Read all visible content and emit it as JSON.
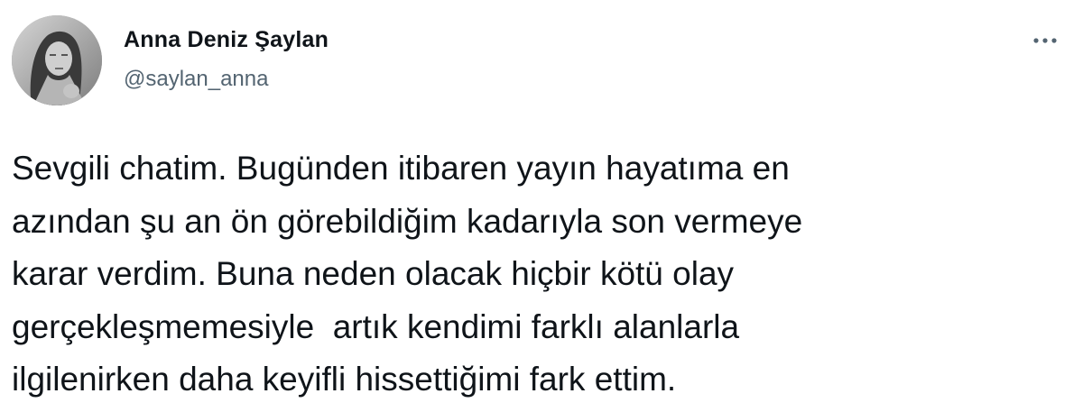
{
  "tweet": {
    "author": {
      "display_name": "Anna Deniz Şaylan",
      "handle": "@saylan_anna",
      "avatar_icon": "profile-photo"
    },
    "more_icon": "ellipsis-horizontal-icon",
    "text": "Sevgili chatim. Bugünden itibaren yayın hayatıma en\nazından şu an ön görebildiğim kadarıyla son vermeye\nkarar verdim. Buna neden olacak hiçbir kötü olay\ngerçekleşmemesiyle  artık kendimi farklı alanlarla\nilgilenirken daha keyifli hissettiğimi fark ettim."
  },
  "colors": {
    "background": "#ffffff",
    "text_primary": "#0f1419",
    "text_secondary": "#536471"
  }
}
